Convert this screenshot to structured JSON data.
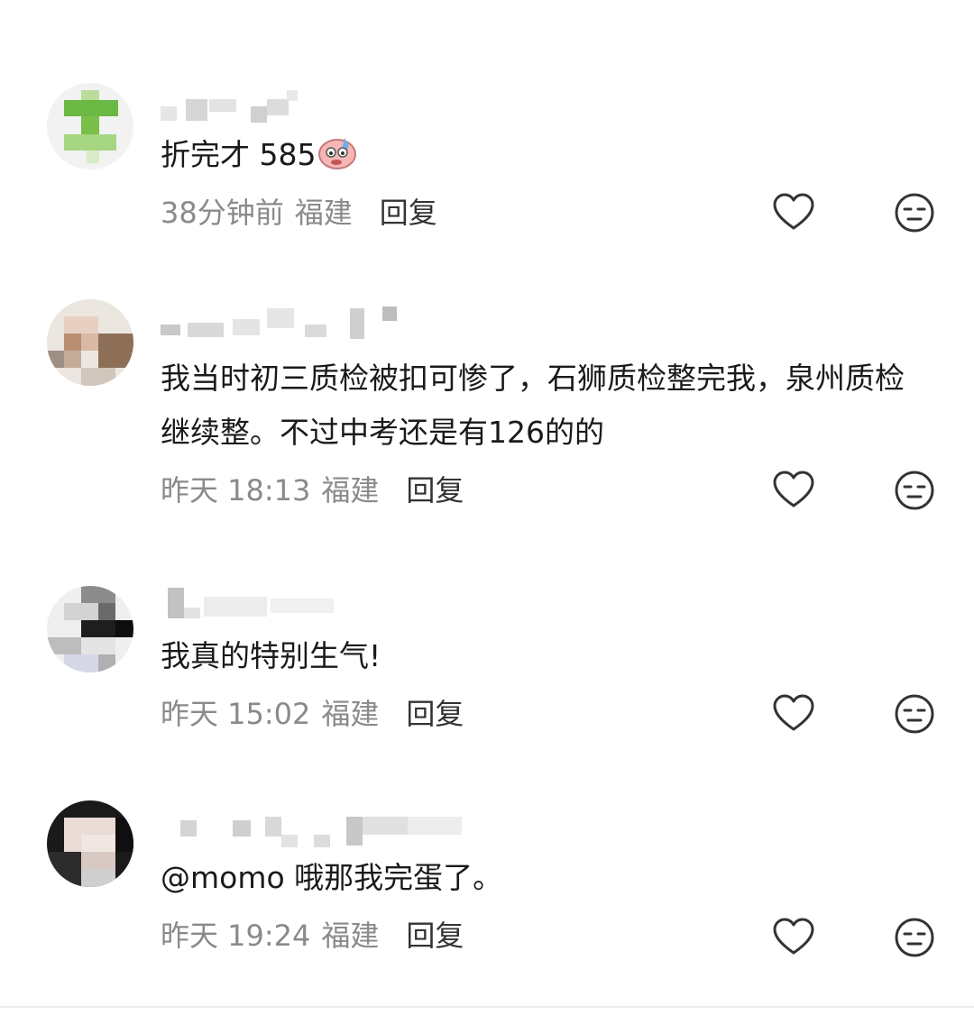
{
  "comments": [
    {
      "text": "折完才 585",
      "emoji": "sweat-face-emoji",
      "time": "38分钟前",
      "location": "福建",
      "reply_label": "回复"
    },
    {
      "text": "我当时初三质检被扣可惨了，石狮质检整完我，泉州质检继续整。不过中考还是有126的的",
      "time": "昨天 18:13",
      "location": "福建",
      "reply_label": "回复"
    },
    {
      "text": "我真的特别生气!",
      "time": "昨天 15:02",
      "location": "福建",
      "reply_label": "回复"
    },
    {
      "text": "@momo 哦那我完蛋了。",
      "time": "昨天 19:24",
      "location": "福建",
      "reply_label": "回复"
    }
  ],
  "icons": {
    "like": "heart-outline-icon",
    "dislike": "neutral-face-icon"
  },
  "colors": {
    "meta_text": "#8a8a8a",
    "reply_text": "#333333",
    "icon_stroke": "#333333"
  }
}
